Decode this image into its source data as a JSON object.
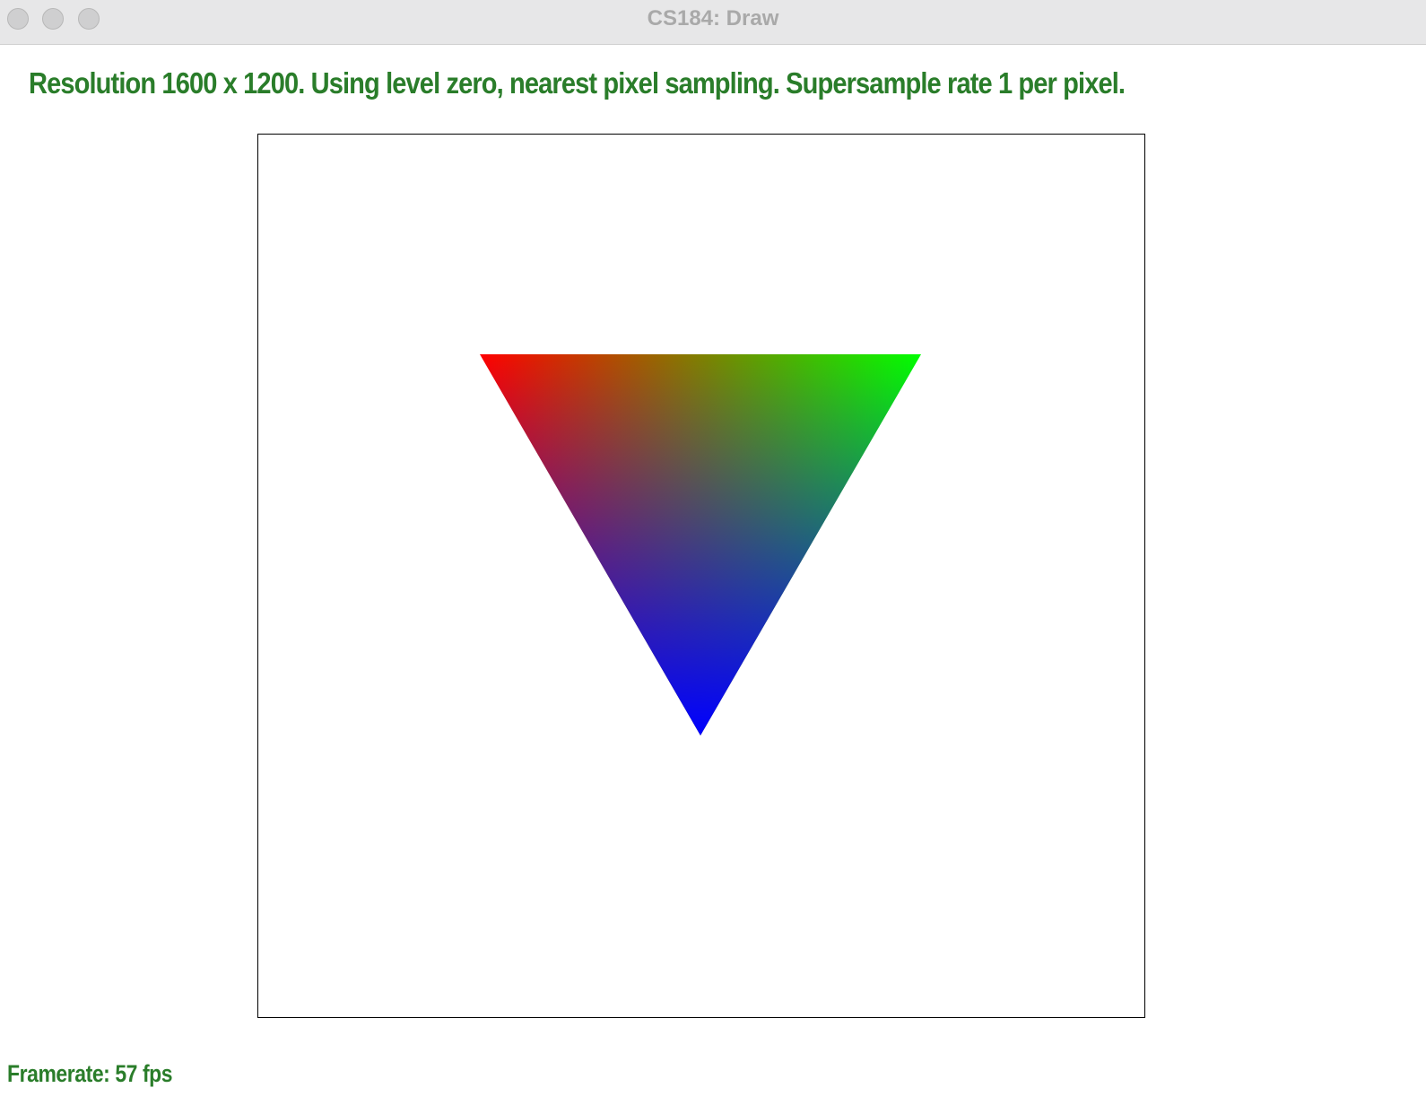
{
  "window": {
    "title": "CS184: Draw"
  },
  "status": {
    "text": "Resolution 1600 x 1200. Using level zero, nearest pixel sampling. Supersample rate 1 per pixel."
  },
  "canvas": {
    "triangle": {
      "vertex_colors": [
        "#ff0000",
        "#00ff00",
        "#0000ff"
      ]
    }
  },
  "footer": {
    "framerate": "Framerate: 57 fps"
  },
  "colors": {
    "label_green": "#2a7d2a",
    "title_gray": "#a9a9a9"
  }
}
